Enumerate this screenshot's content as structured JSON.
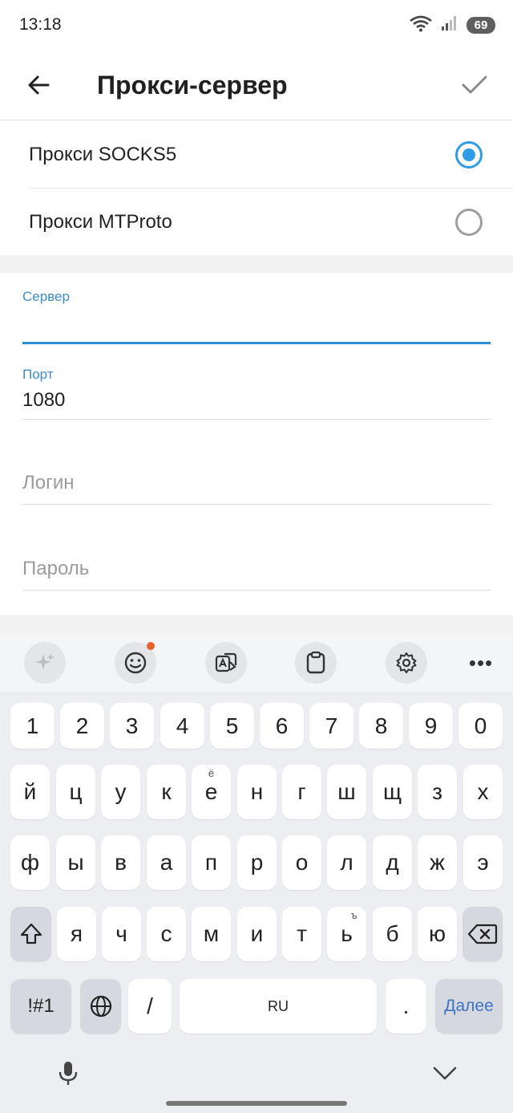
{
  "status": {
    "time": "13:18",
    "battery": "69"
  },
  "app_bar": {
    "title": "Прокси-сервер"
  },
  "proxy_types": [
    {
      "label": "Прокси SOCKS5",
      "selected": true
    },
    {
      "label": "Прокси MTProto",
      "selected": false
    }
  ],
  "form": {
    "server": {
      "label": "Сервер",
      "value": ""
    },
    "port": {
      "label": "Порт",
      "value": "1080"
    },
    "login": {
      "placeholder": "Логин"
    },
    "password": {
      "placeholder": "Пароль"
    }
  },
  "keyboard": {
    "row_numbers": [
      "1",
      "2",
      "3",
      "4",
      "5",
      "6",
      "7",
      "8",
      "9",
      "0"
    ],
    "row1": [
      "й",
      "ц",
      "у",
      "к",
      "е",
      "н",
      "г",
      "ш",
      "щ",
      "з",
      "х"
    ],
    "row1_hint_e": "ё",
    "row2": [
      "ф",
      "ы",
      "в",
      "а",
      "п",
      "р",
      "о",
      "л",
      "д",
      "ж",
      "э"
    ],
    "row3": [
      "я",
      "ч",
      "с",
      "м",
      "и",
      "т",
      "ь",
      "б",
      "ю"
    ],
    "row3_hint_soft": "ъ",
    "symbols_label": "!#1",
    "slash_label": "/",
    "space_label": "RU",
    "period_label": ".",
    "enter_label": "Далее"
  }
}
